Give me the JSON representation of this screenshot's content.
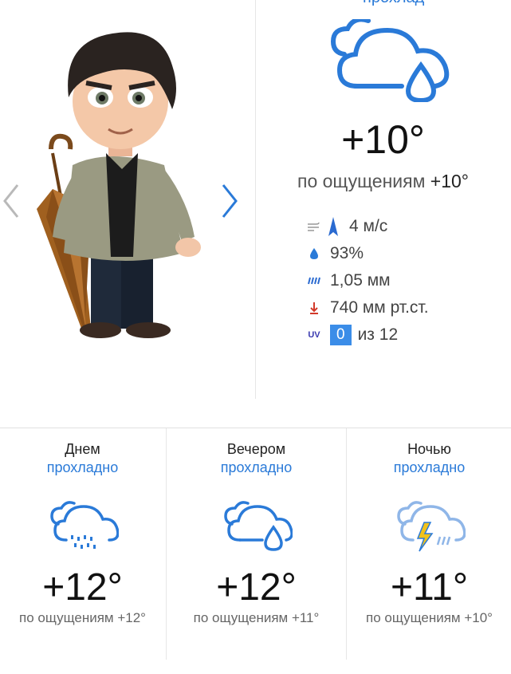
{
  "header": {
    "top_link": "прохлад"
  },
  "current": {
    "icon": "cloud-rain-drop-icon",
    "temperature": "+10°",
    "feels_label": "по ощущениям",
    "feels_value": "+10°",
    "wind": "4 м/с",
    "humidity": "93%",
    "precipitation": "1,05 мм",
    "pressure": "740 мм рт.ст.",
    "uv_label": "UV",
    "uv_value": "0",
    "uv_max": "из 12"
  },
  "periods": [
    {
      "title": "Днем",
      "subtitle": "прохладно",
      "icon": "cloud-heavy-rain-icon",
      "temperature": "+12°",
      "feels": "по ощущениям +12°"
    },
    {
      "title": "Вечером",
      "subtitle": "прохладно",
      "icon": "cloud-rain-drop-icon",
      "temperature": "+12°",
      "feels": "по ощущениям +11°"
    },
    {
      "title": "Ночью",
      "subtitle": "прохладно",
      "icon": "cloud-thunderstorm-icon",
      "temperature": "+11°",
      "feels": "по ощущениям +10°"
    }
  ],
  "colors": {
    "accent": "#2a7ad8",
    "uv_badge": "#3b8de8",
    "pressure_arrow": "#d23a2a"
  }
}
